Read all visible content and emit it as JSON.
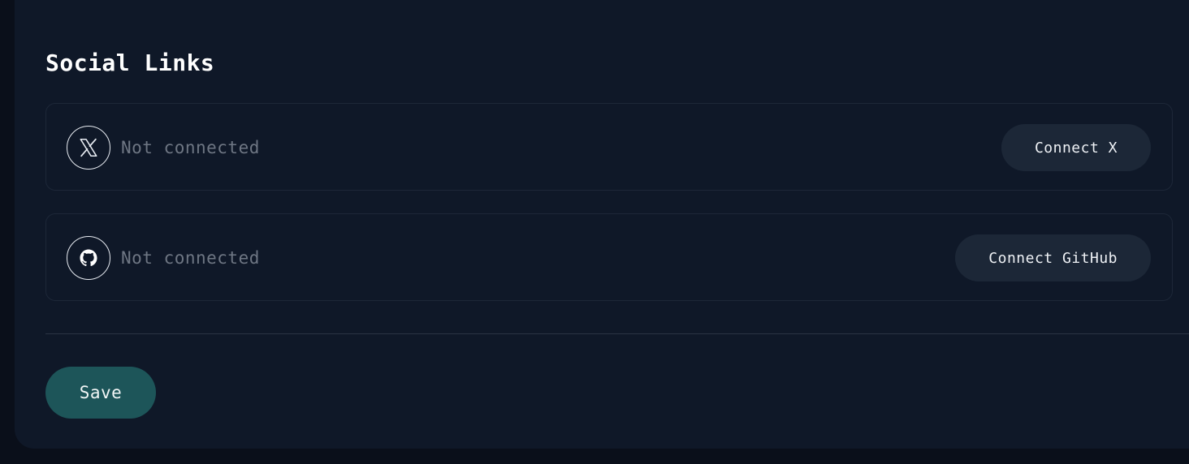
{
  "section": {
    "title": "Social Links"
  },
  "social": {
    "x": {
      "icon": "x-logo-icon",
      "status": "Not connected",
      "button_label": "Connect X"
    },
    "github": {
      "icon": "github-logo-icon",
      "status": "Not connected",
      "button_label": "Connect GitHub"
    }
  },
  "actions": {
    "save_label": "Save"
  },
  "colors": {
    "background": "#0a0f1a",
    "panel": "#0f1828",
    "row_border": "#1d2738",
    "status_text": "#6e7683",
    "connect_button": "#1c2737",
    "save_button": "#1d5559"
  }
}
